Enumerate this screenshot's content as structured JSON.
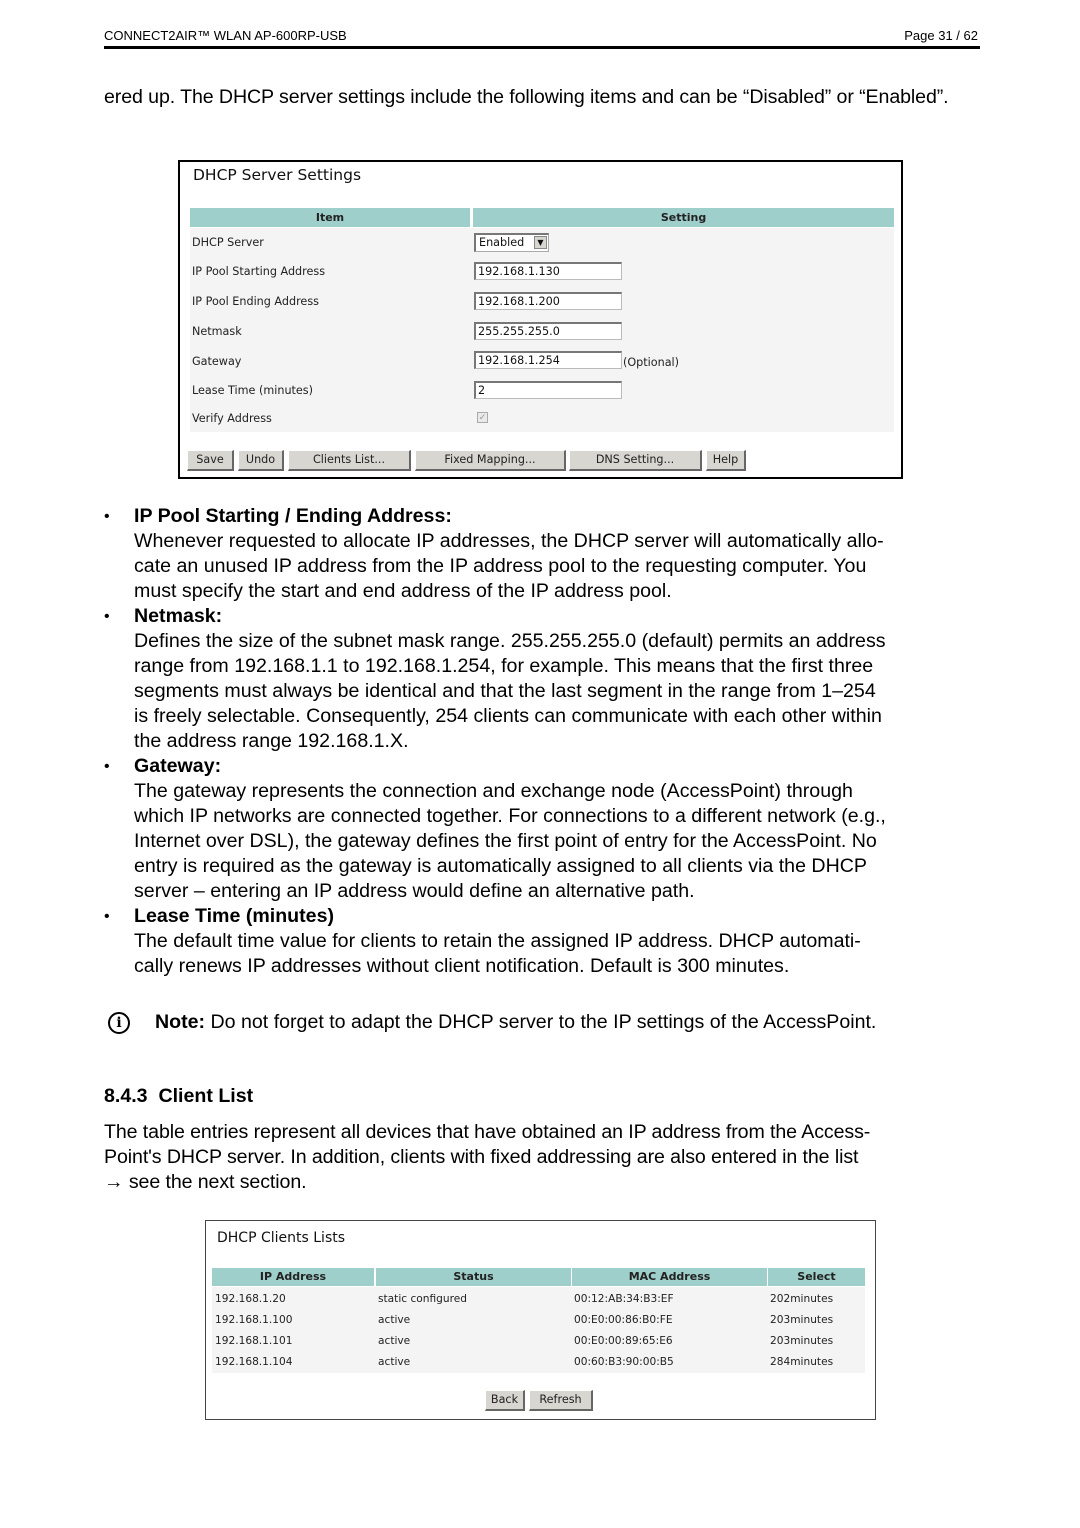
{
  "header": {
    "product": "CONNECT2AIR™ WLAN AP-600RP-USB",
    "page": "Page 31 / 62"
  },
  "intro_text": "ered up. The DHCP server settings include the following items and can be “Disabled” or “Enabled”.",
  "dhcp_settings": {
    "title": "DHCP Server Settings",
    "col_item": "Item",
    "col_setting": "Setting",
    "rows": [
      {
        "label": "DHCP Server",
        "type": "select",
        "value": "Enabled"
      },
      {
        "label": "IP Pool Starting Address",
        "type": "text",
        "value": "192.168.1.130"
      },
      {
        "label": "IP Pool Ending Address",
        "type": "text",
        "value": "192.168.1.200"
      },
      {
        "label": "Netmask",
        "type": "text",
        "value": "255.255.255.0"
      },
      {
        "label": "Gateway",
        "type": "text",
        "value": "192.168.1.254",
        "note": "(Optional)"
      },
      {
        "label": "Lease Time (minutes)",
        "type": "text",
        "value": "2"
      },
      {
        "label": "Verify Address",
        "type": "checkbox",
        "checked": true
      }
    ],
    "buttons": [
      "Save",
      "Undo",
      "Clients List...",
      "Fixed Mapping...",
      "DNS Setting...",
      "Help"
    ]
  },
  "bullets": [
    {
      "title": "IP Pool Starting / Ending Address:",
      "lines": [
        "Whenever requested to allocate IP addresses, the DHCP server will automatically allo-",
        "cate an unused IP address from the IP address pool to the requesting computer. You",
        "must specify the start and end address of the IP address pool."
      ]
    },
    {
      "title": "Netmask:",
      "lines": [
        "Defines the size of the subnet mask range. 255.255.255.0 (default) permits an address",
        "range from 192.168.1.1 to 192.168.1.254, for example. This means that the first three",
        "segments must always be identical and that the last segment in the range from 1–254",
        "is freely selectable. Consequently, 254 clients can communicate with each other within",
        "the address range 192.168.1.X."
      ]
    },
    {
      "title": "Gateway:",
      "lines": [
        "The gateway represents the connection and exchange node (AccessPoint) through",
        "which IP networks are connected together. For connections to a different network (e.g.,",
        "Internet over DSL), the gateway defines the first point of entry for the AccessPoint. No",
        "entry is required as the gateway is automatically assigned to all clients via the DHCP",
        "server – entering an IP address would define an alternative path."
      ]
    },
    {
      "title": "Lease Time (minutes)",
      "lines": [
        "The default time value for clients to retain the assigned IP address. DHCP automati-",
        "cally renews IP addresses without client notification. Default is 300 minutes."
      ]
    }
  ],
  "note": {
    "icon": "info-icon",
    "label": "Note:",
    "text": " Do not forget to adapt the DHCP server to the IP settings of the AccessPoint."
  },
  "section": {
    "heading": "8.4.3  Client List",
    "lines": [
      "The table entries represent all devices that have obtained an IP address from the Access-",
      "Point's DHCP server. In addition, clients with fixed addressing are also entered in the list",
      "→ see the next section."
    ]
  },
  "clients": {
    "title": "DHCP Clients Lists",
    "columns": [
      "IP Address",
      "Status",
      "MAC Address",
      "Select"
    ],
    "rows": [
      [
        "192.168.1.20",
        "static configured",
        "00:12:AB:34:B3:EF",
        "202minutes"
      ],
      [
        "192.168.1.100",
        "active",
        "00:E0:00:86:B0:FE",
        "203minutes"
      ],
      [
        "192.168.1.101",
        "active",
        "00:E0:00:89:65:E6",
        "203minutes"
      ],
      [
        "192.168.1.104",
        "active",
        "00:60:B3:90:00:B5",
        "284minutes"
      ]
    ],
    "buttons": [
      "Back",
      "Refresh"
    ]
  },
  "colors": {
    "grid_header": "#9fcfcb",
    "grid_body": "#f4f4f4",
    "button_face": "#d8d6d0"
  }
}
